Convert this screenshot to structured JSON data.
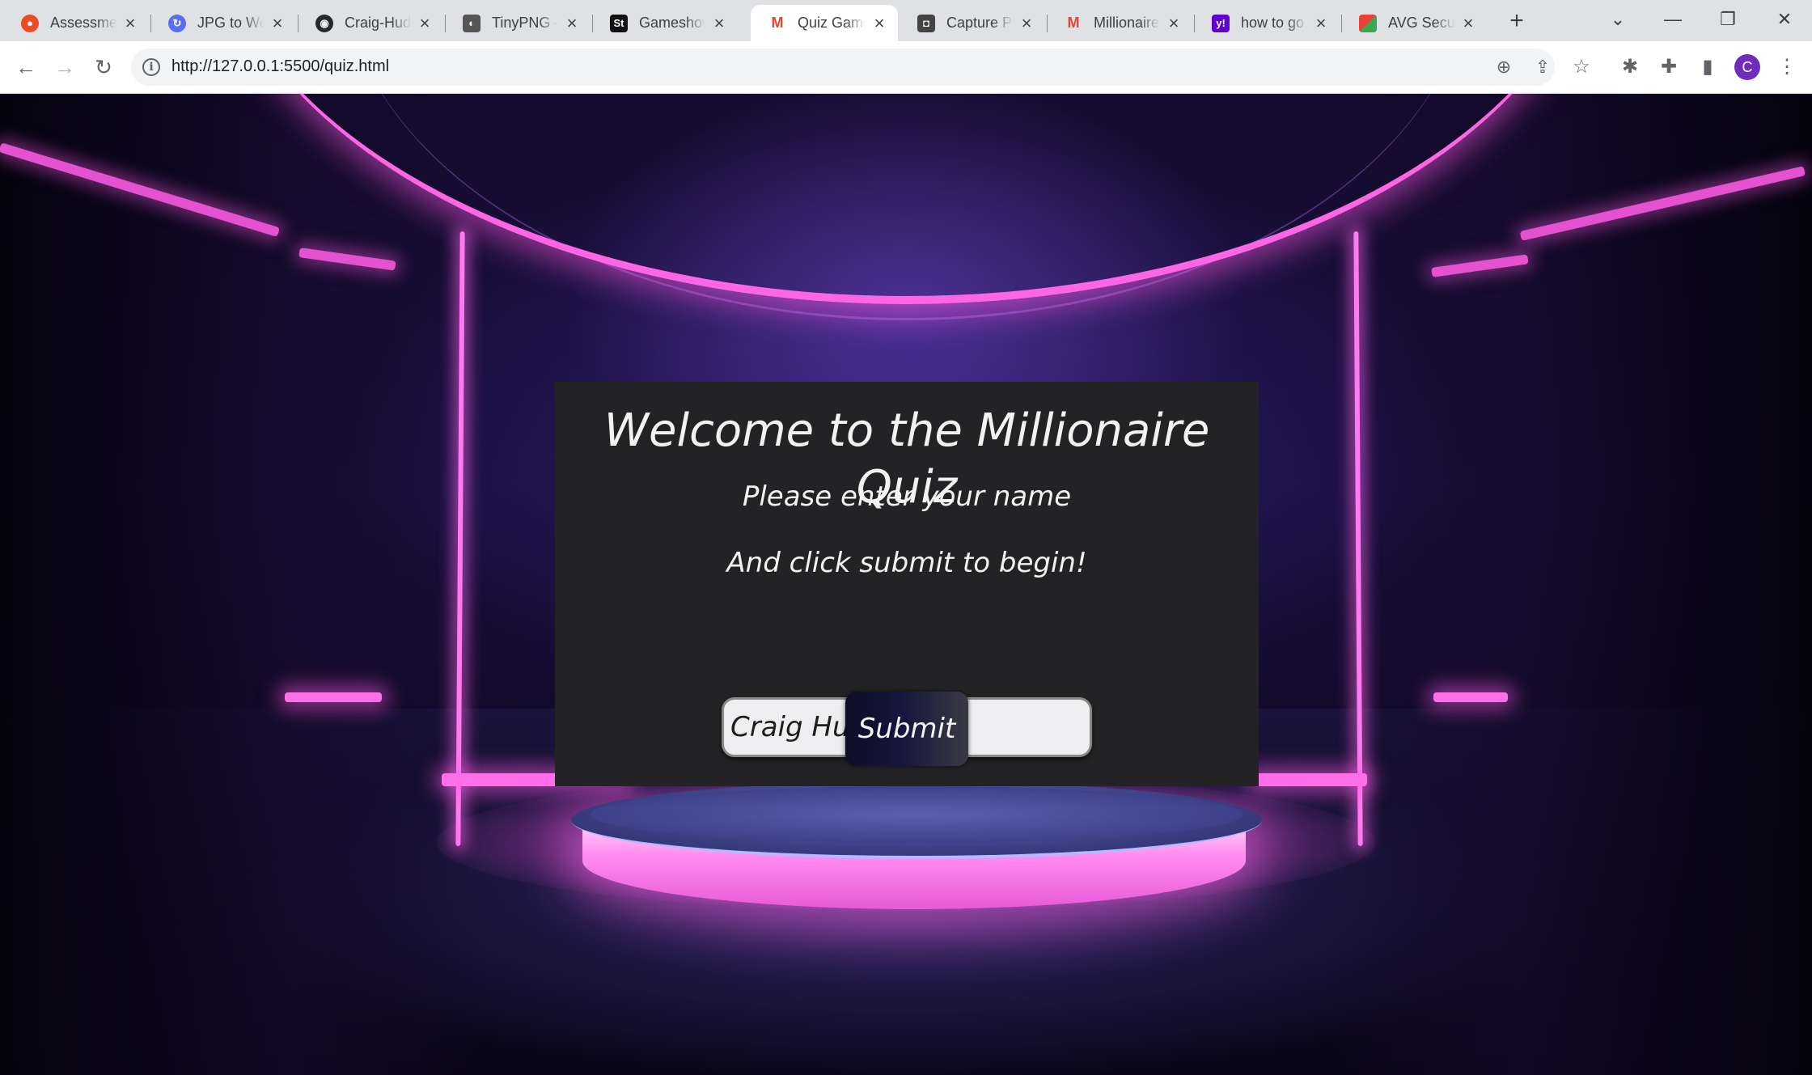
{
  "browser": {
    "tabs": [
      {
        "title": "Assessment",
        "favicon": "circle-orange-icon",
        "color": "#ea4d26"
      },
      {
        "title": "JPG to WebP",
        "favicon": "convert-icon",
        "color": "#5a6ff0"
      },
      {
        "title": "Craig-Hudson",
        "favicon": "github-icon",
        "color": "#24292f"
      },
      {
        "title": "TinyPNG –",
        "favicon": "panda-icon",
        "color": "#333333"
      },
      {
        "title": "Gameshow",
        "favicon": "shutterstock-icon",
        "color": "#111111"
      },
      {
        "title": "Quiz Game",
        "favicon": "gmail-icon",
        "color": "#ea4335",
        "active": true
      },
      {
        "title": "Capture Ph",
        "favicon": "camera-icon",
        "color": "#333333"
      },
      {
        "title": "Millionaire",
        "favicon": "gmail-icon",
        "color": "#ea4335"
      },
      {
        "title": "how to go",
        "favicon": "yahoo-icon",
        "color": "#6001d2"
      },
      {
        "title": "AVG Secur",
        "favicon": "avg-icon",
        "color": "#34a853"
      }
    ],
    "close_glyph": "×",
    "new_tab_glyph": "+",
    "url": "http://127.0.0.1:5500/quiz.html",
    "profile_initial": "C",
    "accent": "#6f2dbd"
  },
  "page": {
    "heading": "Welcome to the Millionaire Quiz",
    "line1": "Please enter your name",
    "line2": "And click submit to begin!",
    "name_value": "Craig Hudson",
    "submit_label": "Submit",
    "neon_color": "#ff66e6",
    "card_color": "#232325"
  }
}
